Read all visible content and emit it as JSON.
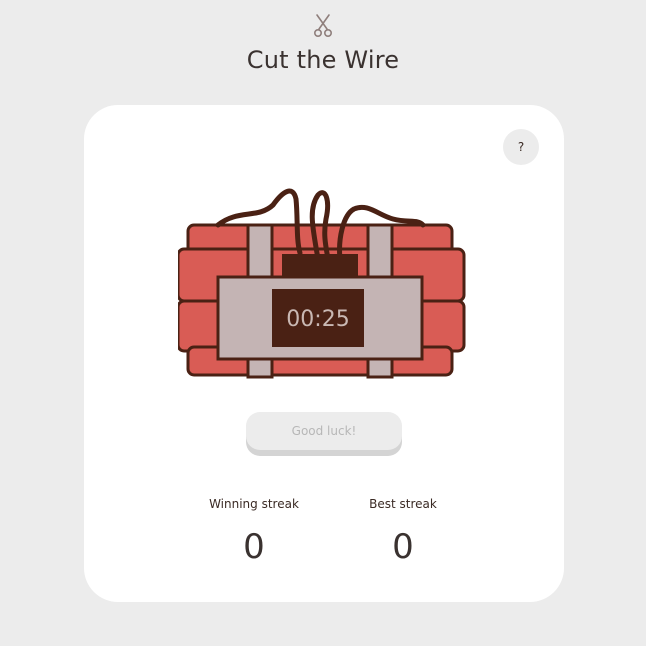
{
  "header": {
    "logo_icon": "scissors-icon",
    "title": "Cut the Wire"
  },
  "help": {
    "label": "?"
  },
  "bomb": {
    "timer": "00:25",
    "wire_color": "#4a2114",
    "stick_color": "#d95c55",
    "panel_color": "#c4b4b4"
  },
  "action": {
    "label": "Good luck!"
  },
  "stats": {
    "winning_streak_label": "Winning streak",
    "winning_streak_value": "0",
    "best_streak_label": "Best streak",
    "best_streak_value": "0"
  }
}
